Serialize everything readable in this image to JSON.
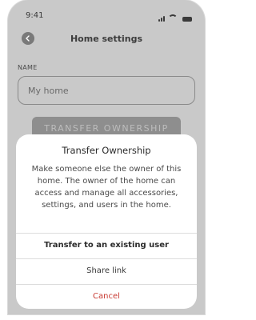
{
  "status_bar": {
    "time": "9:41",
    "signal_icon": "signal-icon",
    "wifi_icon": "wifi-icon",
    "battery_icon": "battery-icon"
  },
  "nav": {
    "title": "Home settings",
    "back_icon": "chevron-left-icon"
  },
  "form": {
    "name_label": "NAME",
    "name_placeholder": "My home",
    "transfer_button": "TRANSFER OWNERSHIP"
  },
  "sheet": {
    "title": "Transfer Ownership",
    "body": "Make someone else the owner of this home. The owner of the home can access and manage all accessories, settings, and users in the home.",
    "actions": {
      "existing_user": "Transfer to an existing user",
      "share_link": "Share link",
      "cancel": "Cancel"
    }
  },
  "colors": {
    "overlay": "#c9c9c9",
    "cancel": "#c83a32"
  }
}
